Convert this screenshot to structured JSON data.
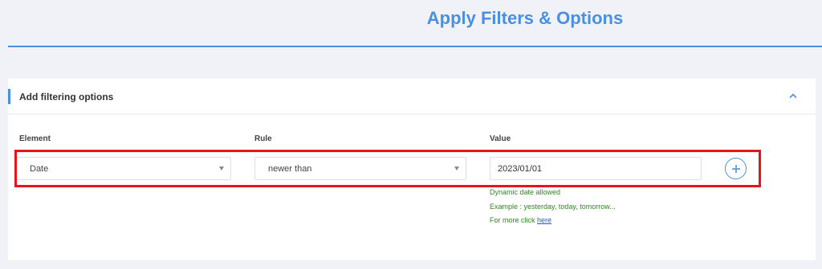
{
  "header": {
    "title": "Apply Filters & Options"
  },
  "panel": {
    "title": "Add filtering options",
    "collapse_icon": "chevron-up-icon"
  },
  "columns": {
    "element_label": "Element",
    "rule_label": "Rule",
    "value_label": "Value"
  },
  "filter_row": {
    "element_value": "Date",
    "rule_value": "newer than",
    "value_value": "2023/01/01",
    "add_icon": "plus-icon"
  },
  "hints": {
    "line1": "Dynamic date allowed",
    "line2": "Example : yesterday, today, tomorrow...",
    "line3_prefix": "For more click",
    "line3_link": "here"
  },
  "colors": {
    "accent": "#4a90e2",
    "highlight": "#e8141c",
    "hint_text": "#2e8b1f"
  }
}
